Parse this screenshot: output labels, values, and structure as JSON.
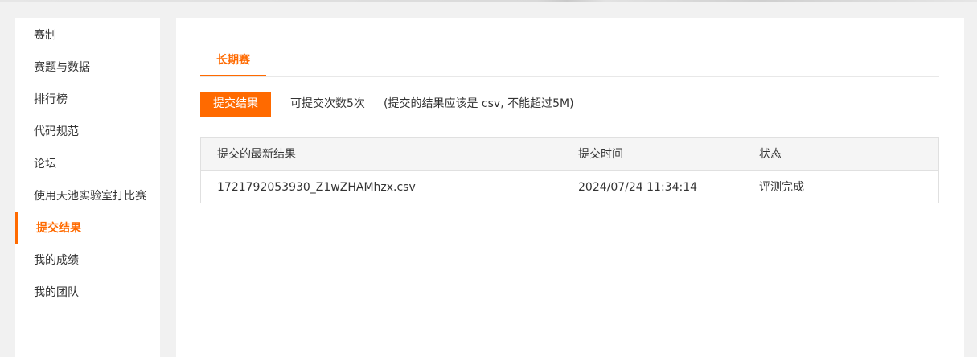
{
  "sidebar": {
    "items": [
      {
        "label": "赛制",
        "active": false
      },
      {
        "label": "赛题与数据",
        "active": false
      },
      {
        "label": "排行榜",
        "active": false
      },
      {
        "label": "代码规范",
        "active": false
      },
      {
        "label": "论坛",
        "active": false
      },
      {
        "label": "使用天池实验室打比赛",
        "active": false
      },
      {
        "label": "提交结果",
        "active": true
      },
      {
        "label": "我的成绩",
        "active": false
      },
      {
        "label": "我的团队",
        "active": false
      }
    ]
  },
  "main": {
    "tabs": [
      {
        "label": "长期赛",
        "active": true
      }
    ],
    "submit_button": "提交结果",
    "submit_count_hint": "可提交次数5次",
    "submit_rule_hint": "(提交的结果应该是 csv, 不能超过5M)",
    "table": {
      "headers": [
        "提交的最新结果",
        "提交时间",
        "状态"
      ],
      "rows": [
        [
          "1721792053930_Z1wZHAMhzx.csv",
          "2024/07/24 11:34:14",
          "评测完成"
        ]
      ]
    }
  },
  "colors": {
    "accent": "#ff6a00",
    "page_background": "#f1f1f1",
    "panel_background": "#ffffff",
    "table_header_background": "#f5f5f5"
  }
}
